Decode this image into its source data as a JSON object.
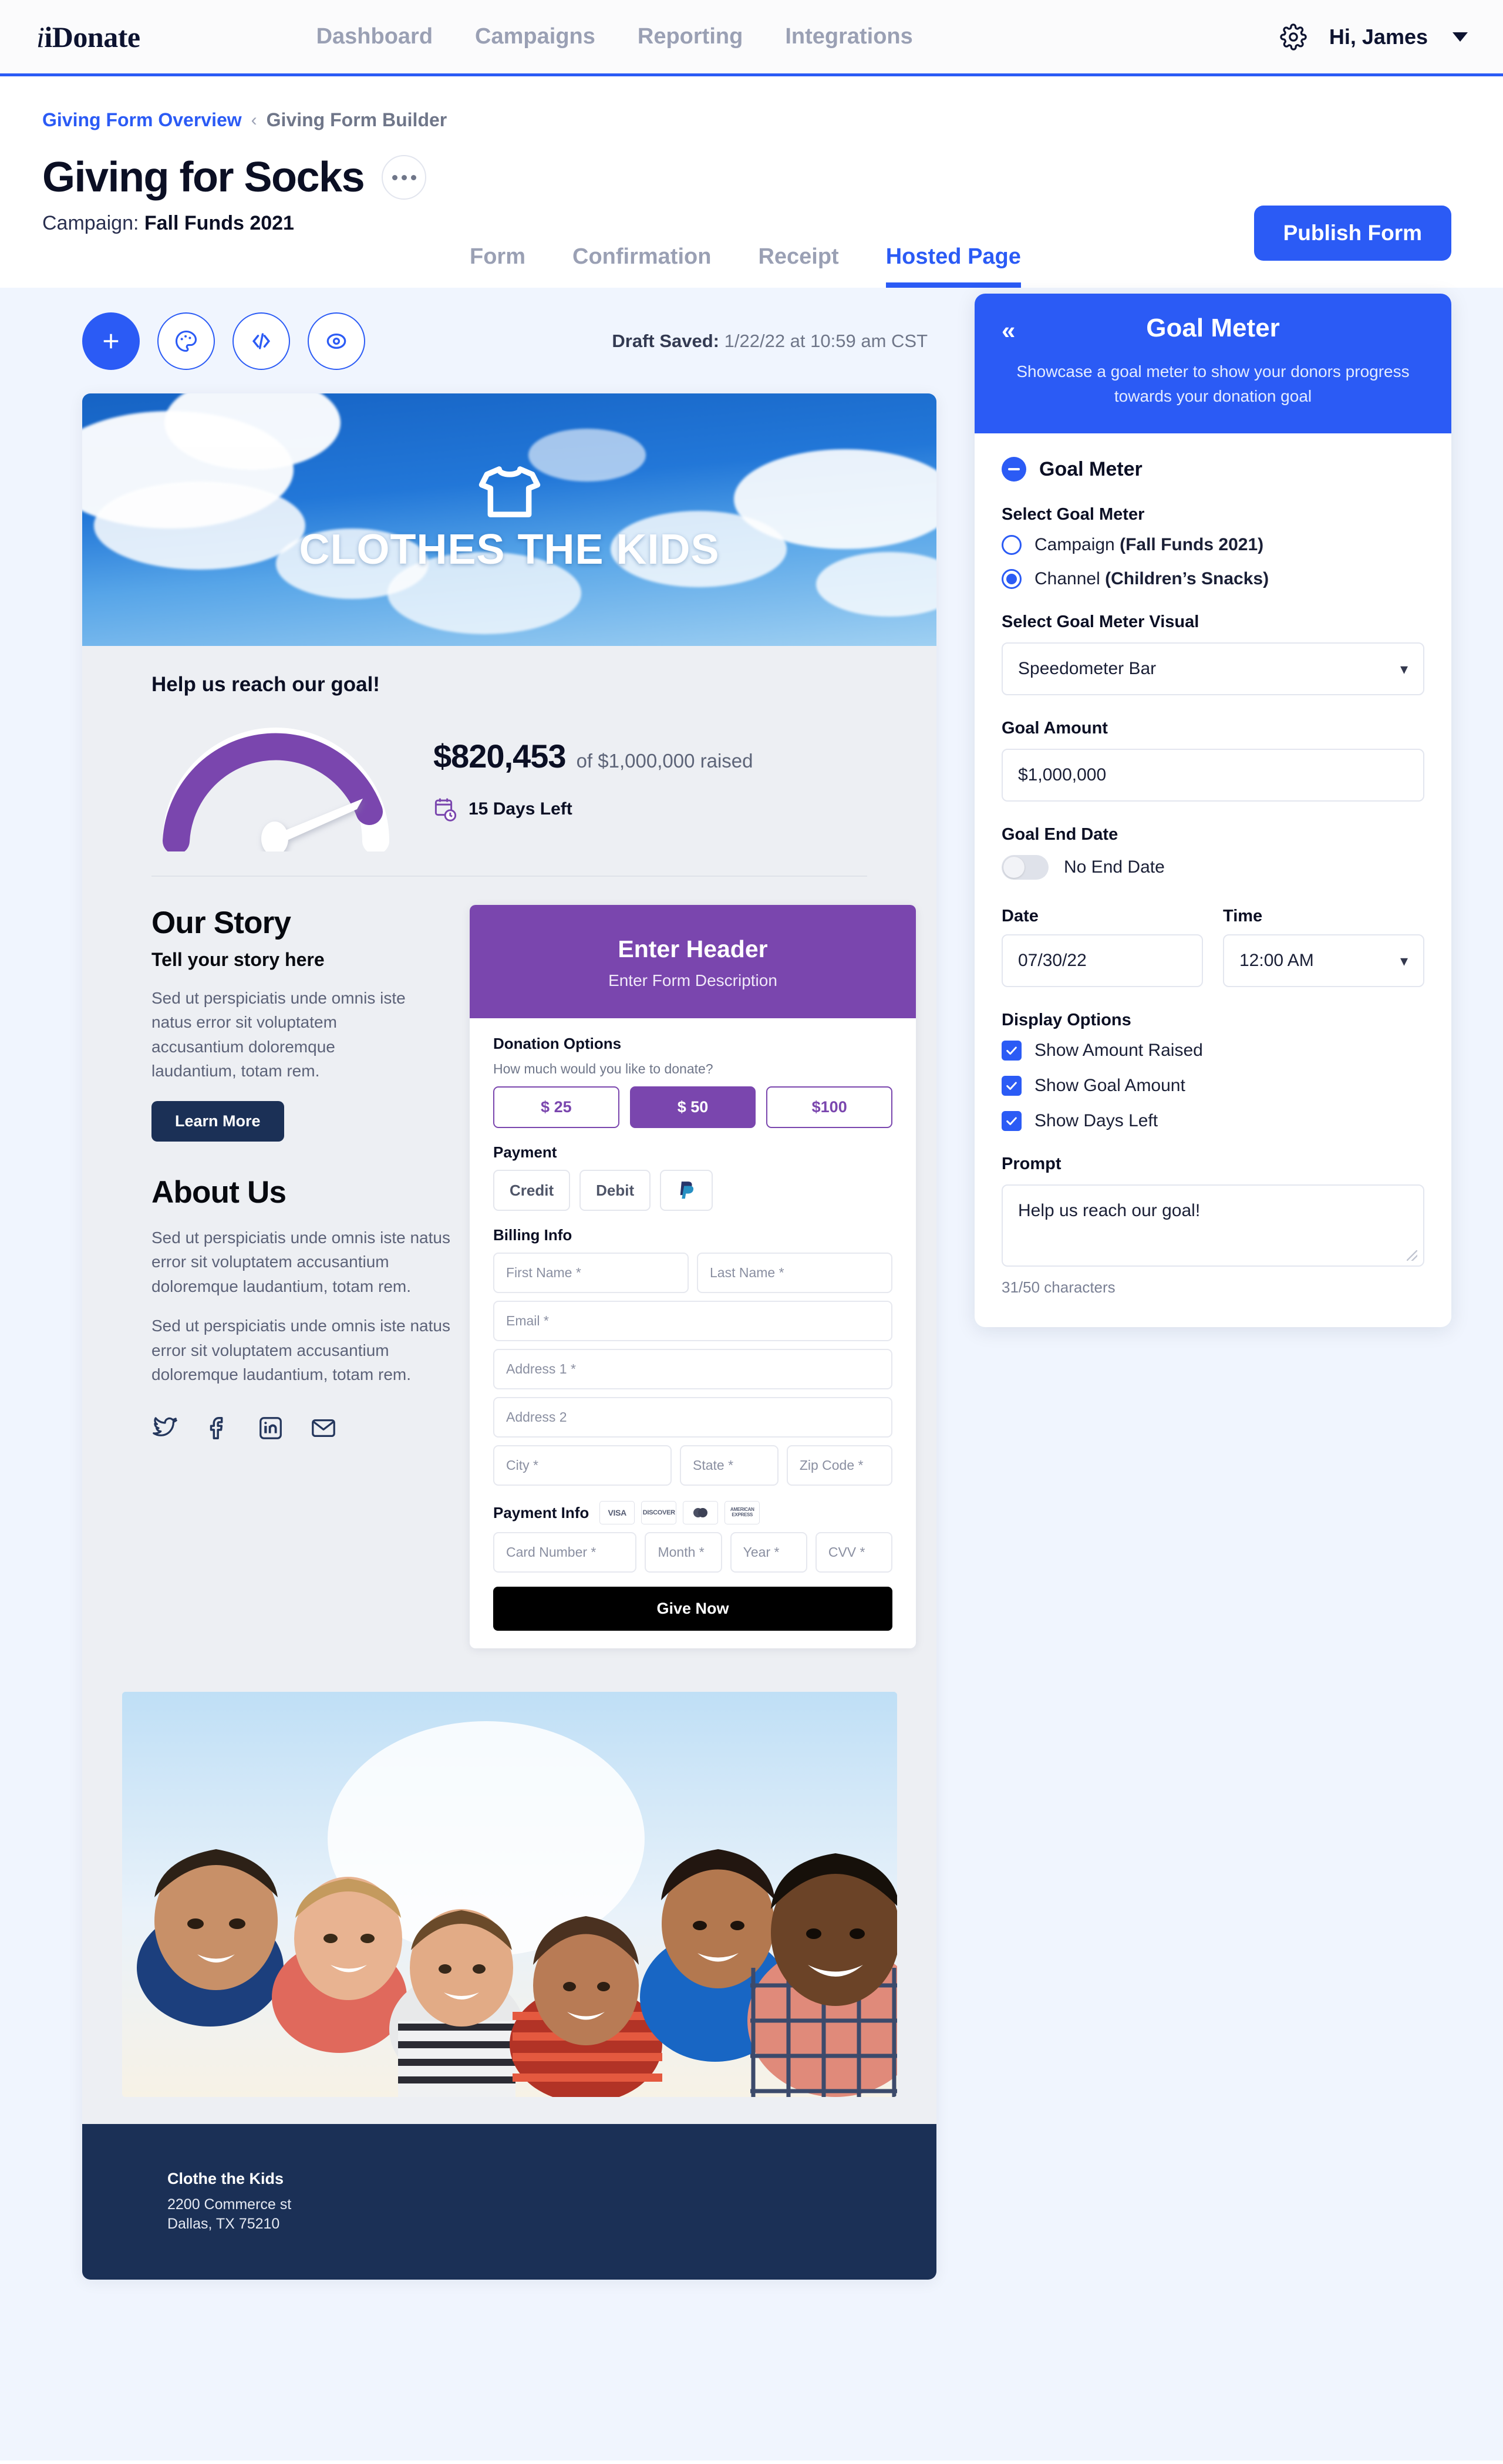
{
  "topnav": {
    "brand": "iDonate",
    "links": [
      "Dashboard",
      "Campaigns",
      "Reporting",
      "Integrations"
    ],
    "user_greeting": "Hi, James"
  },
  "subheader": {
    "breadcrumb_link": "Giving Form Overview",
    "breadcrumb_separator": "‹",
    "breadcrumb_current": "Giving Form Builder",
    "page_title": "Giving for Socks",
    "campaign_label": "Campaign:",
    "campaign_name": "Fall Funds 2021",
    "publish_label": "Publish Form",
    "tabs": [
      {
        "label": "Form",
        "active": false
      },
      {
        "label": "Confirmation",
        "active": false
      },
      {
        "label": "Receipt",
        "active": false
      },
      {
        "label": "Hosted Page",
        "active": true
      }
    ]
  },
  "canvas": {
    "draft_saved_label": "Draft Saved:",
    "draft_saved_value": "1/22/22 at 10:59 am CST",
    "tools": [
      "add-icon",
      "palette-icon",
      "code-icon",
      "preview-eye-icon"
    ]
  },
  "preview": {
    "hero_title": "CLOTHES THE KIDS",
    "goal": {
      "prompt": "Help us reach our goal!",
      "amount_raised": "$820,453",
      "goal_text": "of $1,000,000 raised",
      "days_left": "15 Days Left"
    },
    "story": {
      "heading": "Our Story",
      "subheading": "Tell your story here",
      "body": "Sed ut perspiciatis unde omnis iste natus error sit voluptatem accusantium doloremque laudantium, totam rem.",
      "button": "Learn More"
    },
    "about": {
      "heading": "About Us",
      "paragraph1": "Sed ut perspiciatis unde omnis iste natus error sit voluptatem accusantium doloremque laudantium, totam rem.",
      "paragraph2": "Sed ut perspiciatis unde omnis iste natus error sit voluptatem accusantium doloremque laudantium, totam rem."
    },
    "social": [
      "twitter-icon",
      "facebook-icon",
      "linkedin-icon",
      "email-icon"
    ],
    "form": {
      "header": "Enter Header",
      "description": "Enter Form Description",
      "donation_options_label": "Donation Options",
      "donation_question": "How much would you like to donate?",
      "amounts": [
        "$ 25",
        "$ 50",
        "$100"
      ],
      "selected_amount": "$ 50",
      "payment_label": "Payment",
      "payment_methods": [
        "Credit",
        "Debit",
        "paypal-icon"
      ],
      "billing_label": "Billing Info",
      "fields": {
        "first_name": "First Name *",
        "last_name": "Last Name *",
        "email": "Email *",
        "address1": "Address 1 *",
        "address2": "Address 2",
        "city": "City *",
        "state": "State *",
        "zip": "Zip Code *"
      },
      "payment_info_label": "Payment Info",
      "card_brands": [
        "VISA",
        "DISCOVER",
        "mastercard-icon",
        "AMERICAN EXPRESS"
      ],
      "card_fields": {
        "card_number": "Card Number *",
        "month": "Month *",
        "year": "Year *",
        "cvv": "CVV *"
      },
      "submit": "Give Now"
    },
    "footer": {
      "org": "Clothe the Kids",
      "address_line1": "2200 Commerce st",
      "address_line2": "Dallas, TX 75210"
    }
  },
  "panel": {
    "back_icon": "«",
    "title": "Goal Meter",
    "description": "Showcase a goal meter to show your donors progress towards your donation goal",
    "accordion_label": "Goal Meter",
    "select_goal_meter_label": "Select Goal Meter",
    "radios": [
      {
        "prefix": "Campaign ",
        "bold": "(Fall Funds 2021)",
        "selected": false
      },
      {
        "prefix": "Channel ",
        "bold": "(Children’s Snacks)",
        "selected": true
      }
    ],
    "visual_label": "Select Goal Meter Visual",
    "visual_value": "Speedometer Bar",
    "goal_amount_label": "Goal Amount",
    "goal_amount_value": "$1,000,000",
    "goal_end_date_label": "Goal End Date",
    "no_end_date_label": "No End Date",
    "date_label": "Date",
    "date_value": "07/30/22",
    "time_label": "Time",
    "time_value": "12:00 AM",
    "display_options_label": "Display Options",
    "checkboxes": [
      {
        "label": "Show Amount Raised",
        "checked": true
      },
      {
        "label": "Show Goal Amount",
        "checked": true
      },
      {
        "label": "Show Days Left",
        "checked": true
      }
    ],
    "prompt_label": "Prompt",
    "prompt_value": "Help us reach our goal!",
    "char_count": "31/50 characters"
  },
  "chart_data": {
    "type": "gauge",
    "title": "Help us reach our goal!",
    "value": 820453,
    "max": 1000000,
    "percent": 82,
    "value_label": "$820,453",
    "max_label": "of $1,000,000 raised",
    "fill_color": "#7a46ae",
    "track_color": "#ffffff"
  },
  "colors": {
    "accent_blue": "#2b5bf5",
    "purple": "#7a46ae",
    "navy": "#1b3056",
    "canvas_bg": "#f0f5fe"
  }
}
